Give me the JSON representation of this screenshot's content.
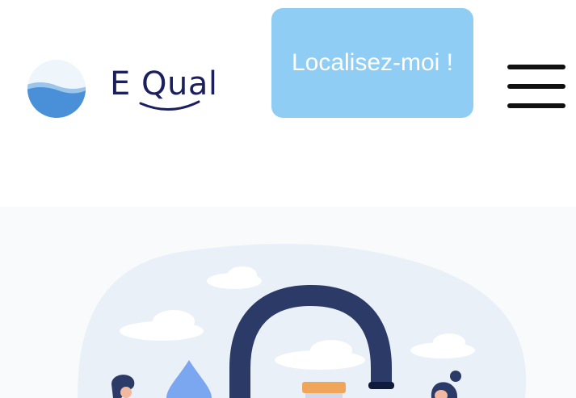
{
  "header": {
    "logo_text": "E Qual",
    "locate_button_label": "Localisez-moi !",
    "menu_icon": "hamburger-menu-icon"
  },
  "colors": {
    "locate_button_bg": "#90cdf4",
    "brand_navy": "#1b1f5e",
    "logo_water_blue": "#4a90d9",
    "hero_bg": "#f8fafc",
    "illustration_faucet": "#2b3a67",
    "illustration_drop": "#7ba7f0"
  },
  "hero": {
    "illustration": "water-faucet-illustration"
  }
}
